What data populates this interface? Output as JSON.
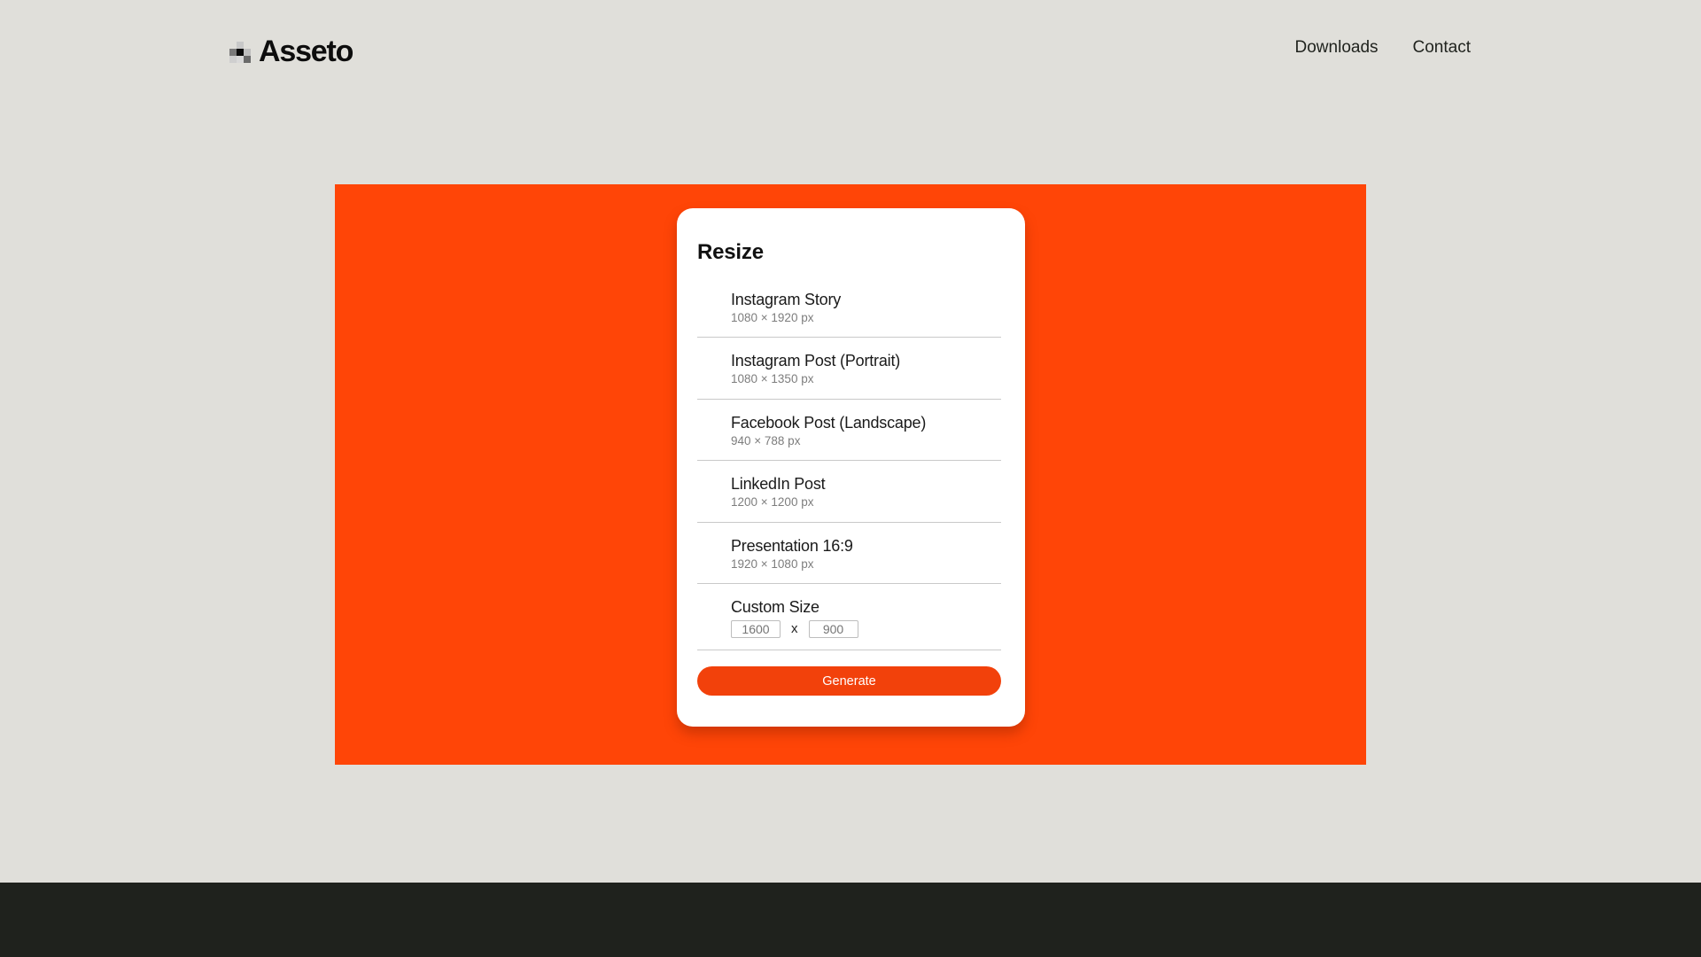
{
  "brand": {
    "name": "Asseto",
    "icon": "pixel-logo-icon"
  },
  "nav": {
    "items": [
      {
        "label": "Downloads"
      },
      {
        "label": "Contact"
      }
    ]
  },
  "colors": {
    "background": "#e0dfda",
    "hero": "#ff4507",
    "button": "#f2410b",
    "footer": "#1f221d"
  },
  "resize": {
    "title": "Resize",
    "presets": [
      {
        "label": "Instagram Story",
        "size": "1080 × 1920 px"
      },
      {
        "label": "Instagram Post (Portrait)",
        "size": "1080 × 1350 px"
      },
      {
        "label": "Facebook Post (Landscape)",
        "size": "940 × 788 px"
      },
      {
        "label": "LinkedIn Post",
        "size": "1200 × 1200 px"
      },
      {
        "label": "Presentation 16:9",
        "size": "1920 × 1080 px"
      }
    ],
    "custom": {
      "label": "Custom Size",
      "width_placeholder": "1600",
      "height_placeholder": "900",
      "separator": "x"
    },
    "generate_label": "Generate"
  }
}
